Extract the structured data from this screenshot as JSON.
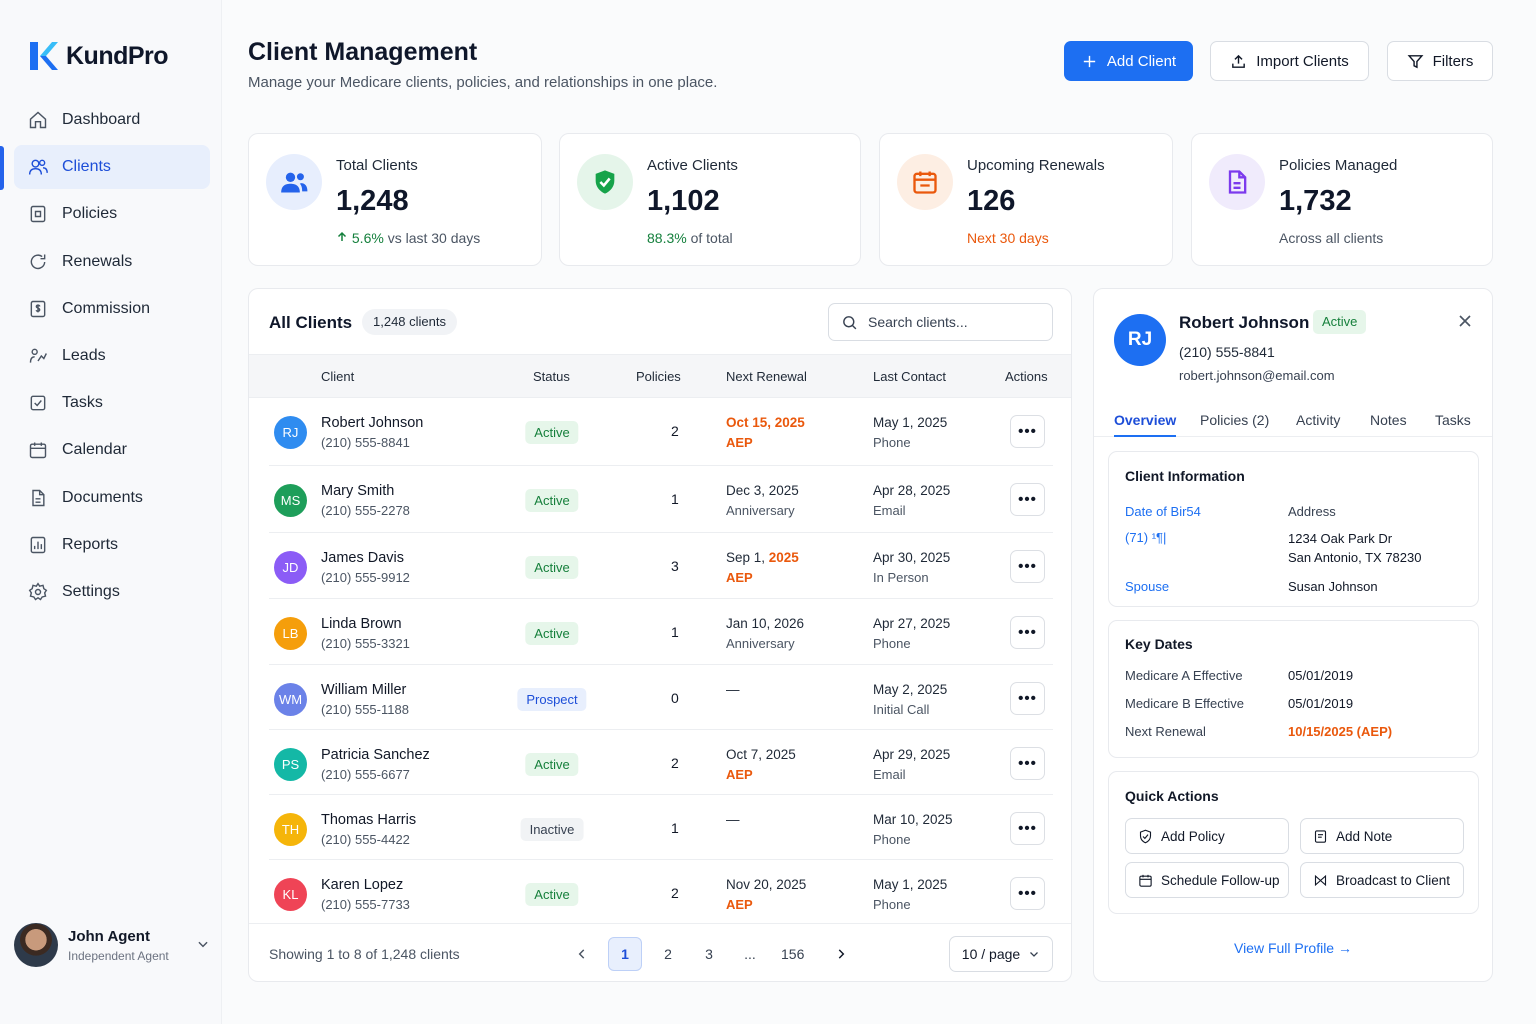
{
  "app": {
    "name": "KundPro"
  },
  "sidebar": {
    "items": [
      {
        "label": "Dashboard",
        "icon": "home-icon"
      },
      {
        "label": "Clients",
        "icon": "users-icon",
        "active": true
      },
      {
        "label": "Policies",
        "icon": "policy-icon"
      },
      {
        "label": "Renewals",
        "icon": "refresh-icon"
      },
      {
        "label": "Commission",
        "icon": "dollar-icon"
      },
      {
        "label": "Leads",
        "icon": "leads-icon"
      },
      {
        "label": "Tasks",
        "icon": "checkbox-icon"
      },
      {
        "label": "Calendar",
        "icon": "calendar-icon"
      },
      {
        "label": "Documents",
        "icon": "document-icon"
      },
      {
        "label": "Reports",
        "icon": "reports-icon"
      },
      {
        "label": "Settings",
        "icon": "gear-icon"
      }
    ],
    "user": {
      "name": "John Agent",
      "role": "Independent Agent"
    }
  },
  "header": {
    "title": "Client Management",
    "subtitle": "Manage your Medicare clients, policies, and relationships in one place.",
    "add_label": "Add Client",
    "import_label": "Import Clients",
    "filters_label": "Filters"
  },
  "stats": [
    {
      "label": "Total Clients",
      "value": "1,248",
      "foot_highlight": "5.6%",
      "foot_text": " vs last 30 days",
      "icon": "users-icon",
      "color": "#2563eb"
    },
    {
      "label": "Active Clients",
      "value": "1,102",
      "foot_highlight": "88.3%",
      "foot_text": " of total",
      "icon": "shield-check-icon",
      "color": "#16a34a"
    },
    {
      "label": "Upcoming Renewals",
      "value": "126",
      "foot_highlight": "Next 30 days",
      "foot_text": "",
      "icon": "calendar-icon",
      "color": "#ea580c"
    },
    {
      "label": "Policies Managed",
      "value": "1,732",
      "foot_highlight": "",
      "foot_text": "Across all clients",
      "icon": "document-icon",
      "color": "#7c3aed"
    }
  ],
  "table": {
    "title": "All Clients",
    "count": "1,248 clients",
    "search_placeholder": "Search clients...",
    "columns": [
      "Client",
      "Status",
      "Policies",
      "Next Renewal",
      "Last Contact",
      "Actions"
    ],
    "rows": [
      {
        "initials": "RJ",
        "color": "#2f8cf0",
        "name": "Robert Johnson",
        "phone": "(210) 555-8841",
        "status": "Active",
        "policies": "2",
        "ren1": "Oct 15, 2025",
        "ren1_orange": true,
        "ren2": "AEP",
        "ren2_orange": true,
        "lc1": "May 1, 2025",
        "lc2": "Phone"
      },
      {
        "initials": "MS",
        "color": "#1e9e5a",
        "name": "Mary Smith",
        "phone": "(210) 555-2278",
        "status": "Active",
        "policies": "1",
        "ren1": "Dec 3, 2025",
        "ren1_orange": false,
        "ren2": "Anniversary",
        "ren2_orange": false,
        "lc1": "Apr 28, 2025",
        "lc2": "Email"
      },
      {
        "initials": "JD",
        "color": "#8b5cf6",
        "name": "James Davis",
        "phone": "(210) 555-9912",
        "status": "Active",
        "policies": "3",
        "ren1a": "Sep 1, ",
        "ren1b": "2025",
        "ren2": "AEP",
        "ren2_orange": true,
        "lc1": "Apr 30, 2025",
        "lc2": "In Person"
      },
      {
        "initials": "LB",
        "color": "#f59e0b",
        "name": "Linda Brown",
        "phone": "(210) 555-3321",
        "status": "Active",
        "policies": "1",
        "ren1": "Jan 10, 2026",
        "ren1_orange": false,
        "ren2": "Anniversary",
        "ren2_orange": false,
        "lc1": "Apr 27, 2025",
        "lc2": "Phone"
      },
      {
        "initials": "WM",
        "color": "#6b82e8",
        "name": "William Miller",
        "phone": "(210) 555-1188",
        "status": "Prospect",
        "policies": "0",
        "ren1": "—",
        "ren1_orange": false,
        "ren2": "",
        "ren2_orange": false,
        "lc1": "May 2, 2025",
        "lc2": "Initial Call"
      },
      {
        "initials": "PS",
        "color": "#14b8a6",
        "name": "Patricia Sanchez",
        "phone": "(210) 555-6677",
        "status": "Active",
        "policies": "2",
        "ren1": "Oct 7, 2025",
        "ren1_orange": false,
        "ren2": "AEP",
        "ren2_orange": true,
        "lc1": "Apr 29, 2025",
        "lc2": "Email"
      },
      {
        "initials": "TH",
        "color": "#f5b50a",
        "name": "Thomas Harris",
        "phone": "(210) 555-4422",
        "status": "Inactive",
        "policies": "1",
        "ren1": "—",
        "ren1_orange": false,
        "ren2": "",
        "ren2_orange": false,
        "lc1": "Mar 10, 2025",
        "lc2": "Phone"
      },
      {
        "initials": "KL",
        "color": "#ef4456",
        "name": "Karen Lopez",
        "phone": "(210) 555-7733",
        "status": "Active",
        "policies": "2",
        "ren1": "Nov 20, 2025",
        "ren1_orange": false,
        "ren2": "AEP",
        "ren2_orange": true,
        "lc1": "May 1, 2025",
        "lc2": "Phone"
      }
    ],
    "showing": "Showing 1 to 8 of 1,248 clients",
    "pages": [
      "1",
      "2",
      "3",
      "...",
      "156"
    ],
    "current_page": "1",
    "per_page": "10 / page"
  },
  "detail": {
    "initials": "RJ",
    "name": "Robert Johnson",
    "status": "Active",
    "phone": "(210) 555-8841",
    "email": "robert.johnson@email.com",
    "tabs": [
      "Overview",
      "Policies (2)",
      "Activity",
      "Notes",
      "Tasks"
    ],
    "client_info": {
      "title": "Client Information",
      "dob_label": "Date of Bir54",
      "dob_value": "(71) ¹¶|",
      "address_label": "Address",
      "address_line1": "1234 Oak Park Dr",
      "address_line2": "San Antonio, TX 78230",
      "spouse_label": "Spouse",
      "spouse_value": "Susan Johnson"
    },
    "key_dates": {
      "title": "Key Dates",
      "items": [
        {
          "label": "Medicare A Effective",
          "value": "05/01/2019",
          "highlight": false
        },
        {
          "label": "Medicare B Effective",
          "value": "05/01/2019",
          "highlight": false
        },
        {
          "label": "Next Renewal",
          "value": "10/15/2025 (AEP)",
          "highlight": true
        }
      ]
    },
    "quick_actions": {
      "title": "Quick Actions",
      "items": [
        {
          "label": "Add Policy",
          "icon": "shield-icon"
        },
        {
          "label": "Add Note",
          "icon": "note-icon"
        },
        {
          "label": "Schedule Follow-up",
          "icon": "calendar-icon"
        },
        {
          "label": "Broadcast to Client",
          "icon": "broadcast-icon"
        }
      ]
    },
    "view_full": "View Full Profile →"
  }
}
